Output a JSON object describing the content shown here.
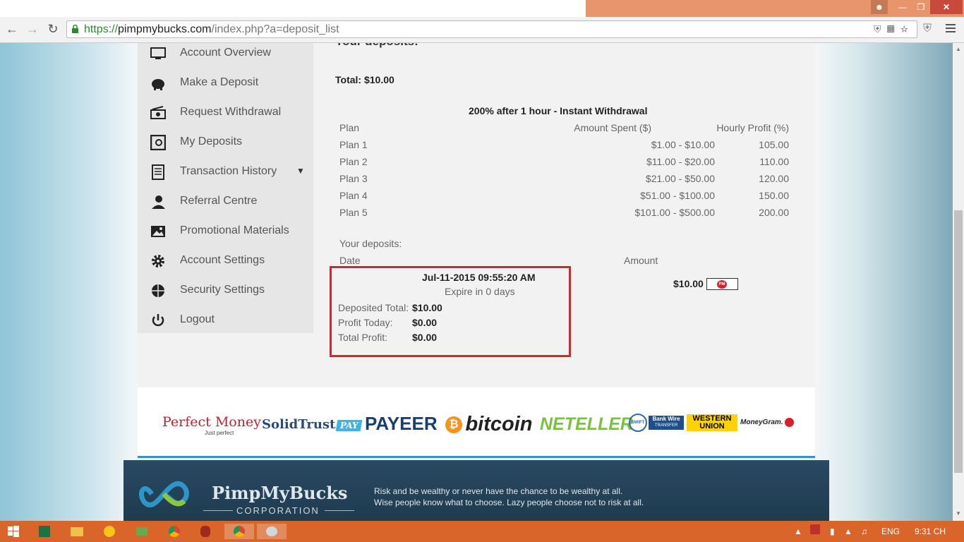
{
  "browser": {
    "url_scheme": "https://",
    "url_host": "pimpmybucks.com",
    "url_path": "/index.php?a=deposit_list"
  },
  "sidebar": {
    "items": [
      {
        "label": "Account Overview",
        "icon": "monitor-icon"
      },
      {
        "label": "Make a Deposit",
        "icon": "piggy-bank-icon"
      },
      {
        "label": "Request Withdrawal",
        "icon": "cash-icon"
      },
      {
        "label": "My Deposits",
        "icon": "safe-icon"
      },
      {
        "label": "Transaction History",
        "icon": "document-list-icon"
      },
      {
        "label": "Referral Centre",
        "icon": "users-icon"
      },
      {
        "label": "Promotional Materials",
        "icon": "image-icon"
      },
      {
        "label": "Account Settings",
        "icon": "gear-icon"
      },
      {
        "label": "Security Settings",
        "icon": "globe-lock-icon"
      },
      {
        "label": "Logout",
        "icon": "power-icon"
      }
    ],
    "caret": "▼"
  },
  "main": {
    "page_title": "Your deposits:",
    "total": "Total: $10.00",
    "plan_title": "200% after 1 hour - Instant Withdrawal",
    "plan_headers": [
      "Plan",
      "Amount Spent ($)",
      "Hourly Profit (%)"
    ],
    "plans": [
      {
        "name": "Plan 1",
        "range": "$1.00 - $10.00",
        "profit": "105.00"
      },
      {
        "name": "Plan 2",
        "range": "$11.00 - $20.00",
        "profit": "110.00"
      },
      {
        "name": "Plan 3",
        "range": "$21.00 - $50.00",
        "profit": "120.00"
      },
      {
        "name": "Plan 4",
        "range": "$51.00 - $100.00",
        "profit": "150.00"
      },
      {
        "name": "Plan 5",
        "range": "$101.00 - $500.00",
        "profit": "200.00"
      }
    ],
    "your_deposits_label": "Your deposits:",
    "col_date": "Date",
    "col_amount": "Amount",
    "deposit": {
      "date": "Jul-11-2015 09:55:20 AM",
      "expire": "Expire in 0 days",
      "deposited_label": "Deposited Total:",
      "deposited_value": "$10.00",
      "profit_today_label": "Profit Today:",
      "profit_today_value": "$0.00",
      "total_profit_label": "Total Profit:",
      "total_profit_value": "$0.00",
      "amount": "$10.00",
      "badge": "PM"
    }
  },
  "payments": {
    "perfect_money": "Perfect Money",
    "perfect_money_sub": "Just perfect",
    "solidtrust": "SolidTrust",
    "solidtrust_pay": "PAY",
    "payeer": "PAYEER",
    "bitcoin": "bitcoin",
    "neteller": "NETELLER",
    "swift": "SWIFT",
    "bank_wire": "Bank Wire",
    "bank_wire_sub": "TRANSFER",
    "western": "WESTERN",
    "union": "UNION",
    "moneygram": "MoneyGram."
  },
  "footer": {
    "brand": "PimpMyBucks",
    "corp": "CORPORATION",
    "tagline1": "Risk and be wealthy or never have the chance to be wealthy at all.",
    "tagline2": "Wise people know what to choose. Lazy people choose not to risk at all."
  },
  "taskbar": {
    "lang": "ENG",
    "time": "9:31 CH"
  },
  "colors": {
    "highlight_box": "#d9232e",
    "taskbar": "#d9652a",
    "titlebar_accent": "#e8956b"
  }
}
